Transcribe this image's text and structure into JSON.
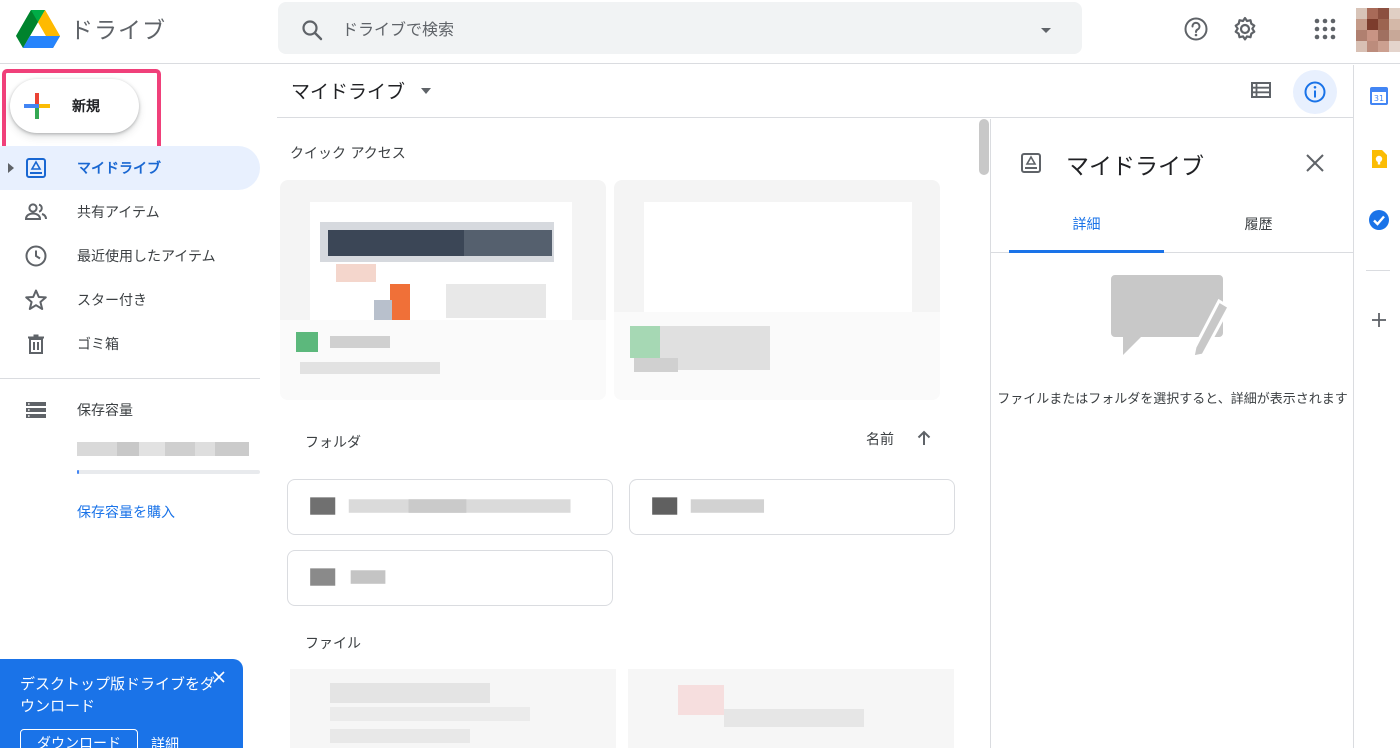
{
  "header": {
    "app_title": "ドライブ",
    "search_placeholder": "ドライブで検索",
    "icons": [
      "drive-logo-icon",
      "search-icon",
      "search-options-icon",
      "help-icon",
      "settings-icon",
      "apps-icon"
    ]
  },
  "sidebar": {
    "new_label": "新規",
    "items": [
      {
        "label": "マイドライブ",
        "icon": "my-drive-icon",
        "active": true
      },
      {
        "label": "共有アイテム",
        "icon": "shared-icon",
        "active": false
      },
      {
        "label": "最近使用したアイテム",
        "icon": "recent-icon",
        "active": false
      },
      {
        "label": "スター付き",
        "icon": "star-icon",
        "active": false
      },
      {
        "label": "ゴミ箱",
        "icon": "trash-icon",
        "active": false
      }
    ],
    "storage_label": "保存容量",
    "buy_storage_label": "保存容量を購入",
    "promo": {
      "text": "デスクトップ版ドライブをダウンロード",
      "download_label": "ダウンロード",
      "details_label": "詳細"
    }
  },
  "main": {
    "breadcrumb": "マイドライブ",
    "quick_access_title": "クイック アクセス",
    "folders_title": "フォルダ",
    "sort_label": "名前",
    "files_title": "ファイル"
  },
  "details": {
    "title": "マイドライブ",
    "tab_details": "詳細",
    "tab_activity": "履歴",
    "empty_text": "ファイルまたはフォルダを選択すると、詳細が表示されます"
  },
  "side_apps": {
    "calendar_date": "31",
    "icons": [
      "calendar-icon",
      "keep-icon",
      "tasks-icon",
      "add-addon-icon"
    ]
  },
  "colors": {
    "accent_blue": "#1a73e8",
    "active_nav_bg": "#e8f0fe",
    "highlight_pink": "#f0407a",
    "promo_blue": "#1a73e8"
  }
}
